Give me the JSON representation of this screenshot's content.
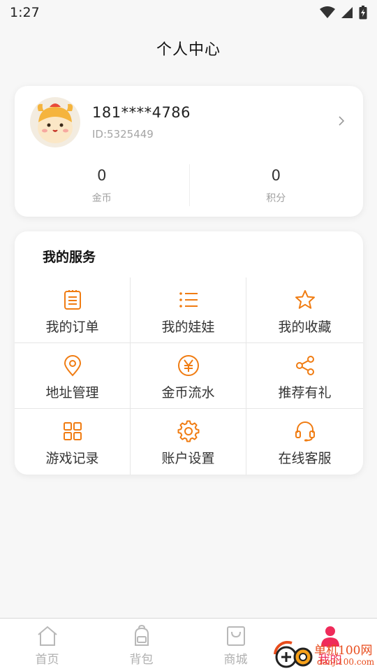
{
  "status_bar": {
    "time": "1:27"
  },
  "header": {
    "title": "个人中心"
  },
  "profile": {
    "phone": "181****4786",
    "id": "ID:5325449",
    "stats": [
      {
        "value": "0",
        "label": "金币"
      },
      {
        "value": "0",
        "label": "积分"
      }
    ]
  },
  "services": {
    "title": "我的服务",
    "items": [
      {
        "label": "我的订单",
        "icon": "clipboard-list-icon"
      },
      {
        "label": "我的娃娃",
        "icon": "list-icon"
      },
      {
        "label": "我的收藏",
        "icon": "star-icon"
      },
      {
        "label": "地址管理",
        "icon": "location-pin-icon"
      },
      {
        "label": "金币流水",
        "icon": "yen-coin-icon"
      },
      {
        "label": "推荐有礼",
        "icon": "share-icon"
      },
      {
        "label": "游戏记录",
        "icon": "grid-icon"
      },
      {
        "label": "账户设置",
        "icon": "gear-icon"
      },
      {
        "label": "在线客服",
        "icon": "headset-icon"
      }
    ]
  },
  "bottom_nav": {
    "items": [
      {
        "label": "首页",
        "icon": "home-icon"
      },
      {
        "label": "背包",
        "icon": "backpack-icon"
      },
      {
        "label": "商城",
        "icon": "shopping-bag-icon"
      },
      {
        "label": "我的",
        "icon": "person-icon",
        "active": true
      }
    ]
  },
  "watermark": {
    "text": "单机100网",
    "sub": "danji100.com"
  },
  "colors": {
    "accent": "#f07c12",
    "active_nav": "#ef2b5a",
    "background": "#f7f7f7"
  }
}
